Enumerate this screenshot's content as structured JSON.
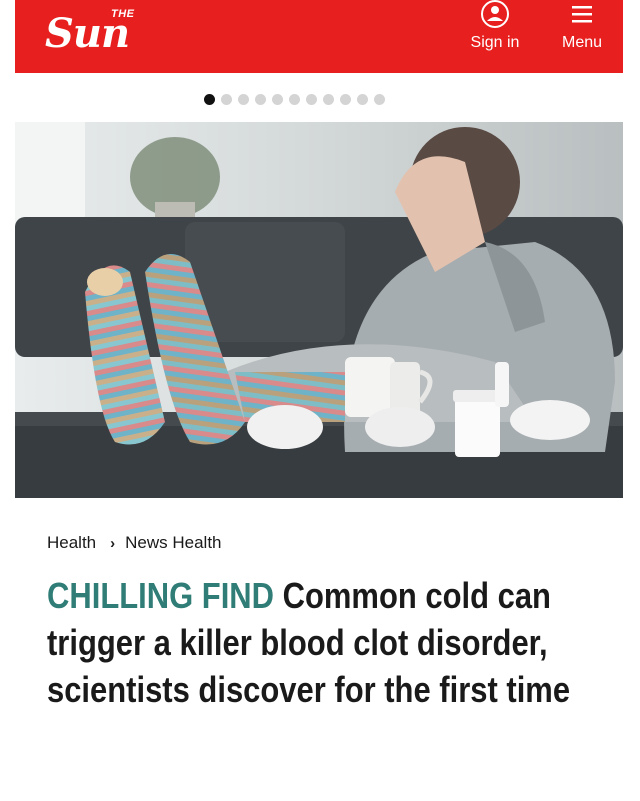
{
  "header": {
    "logo_the": "THE",
    "logo_word": "Sun",
    "signin_label": "Sign in",
    "menu_label": "Menu",
    "signin_icon": "user-circle-icon",
    "menu_icon": "hamburger-icon",
    "bg_color": "#e81f1f"
  },
  "carousel": {
    "total": 11,
    "active_index": 0
  },
  "hero": {
    "image": "photo: person with a cold on sofa, striped socks, mug, tissues, pill bottle"
  },
  "breadcrumb": {
    "items": [
      "Health",
      "News Health"
    ],
    "separator_icon": "chevron-right-icon"
  },
  "article": {
    "kicker": "CHILLING FIND",
    "headline": "Common cold can trigger a killer blood clot disorder, scientists discover for the first time",
    "kicker_color": "#2f7d76"
  }
}
